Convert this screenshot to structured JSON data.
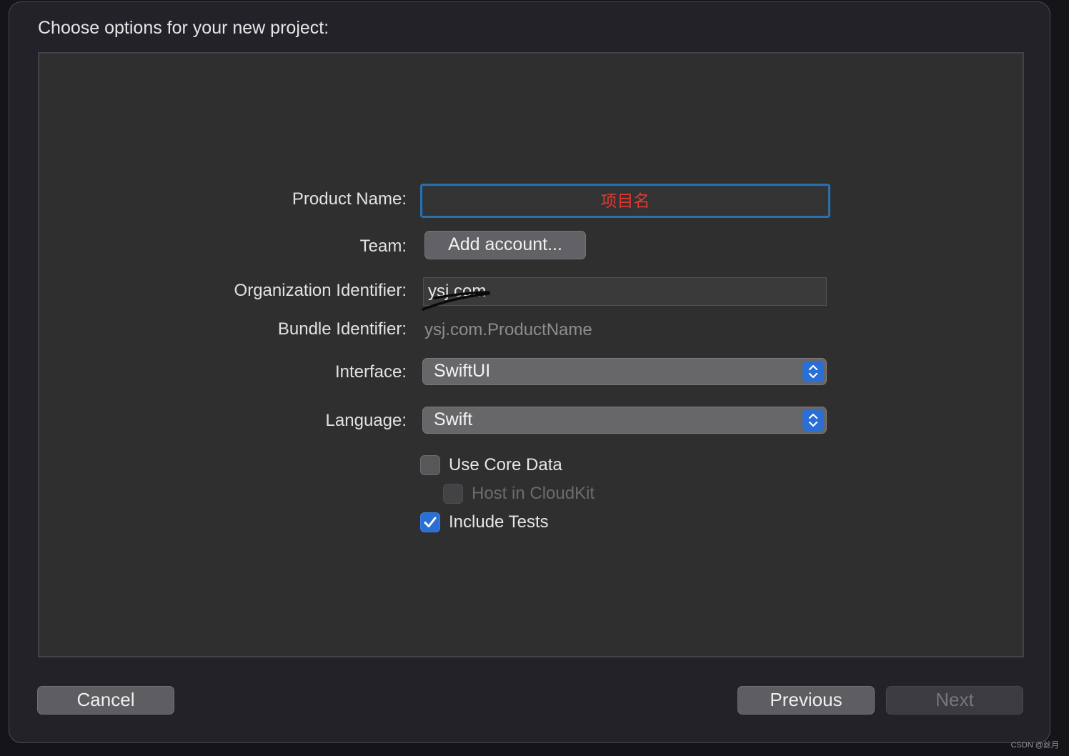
{
  "dialog": {
    "title": "Choose options for your new project:"
  },
  "form": {
    "product_name": {
      "label": "Product Name:",
      "value": "项目名"
    },
    "team": {
      "label": "Team:",
      "button_label": "Add account..."
    },
    "organization_identifier": {
      "label": "Organization Identifier:",
      "value": "ysj.com"
    },
    "bundle_identifier": {
      "label": "Bundle Identifier:",
      "value": "ysj.com.ProductName"
    },
    "interface": {
      "label": "Interface:",
      "selected": "SwiftUI"
    },
    "language": {
      "label": "Language:",
      "selected": "Swift"
    },
    "checkboxes": {
      "use_core_data": {
        "label": "Use Core Data",
        "checked": false
      },
      "host_in_cloudkit": {
        "label": "Host in CloudKit",
        "checked": false,
        "enabled": false
      },
      "include_tests": {
        "label": "Include Tests",
        "checked": true
      }
    }
  },
  "footer": {
    "cancel_label": "Cancel",
    "previous_label": "Previous",
    "next_label": "Next"
  },
  "watermark": "CSDN @丝月",
  "colors": {
    "accent": "#2a6fd6",
    "focus_ring": "#2d6fa8",
    "product_name_text": "#e5382f"
  }
}
